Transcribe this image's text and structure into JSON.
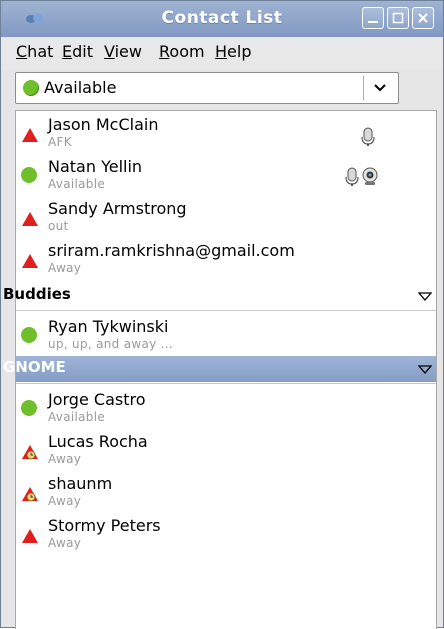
{
  "window": {
    "title": "Contact List"
  },
  "menu": {
    "items": [
      {
        "mnemonic": "C",
        "rest": "hat"
      },
      {
        "mnemonic": "E",
        "rest": "dit"
      },
      {
        "mnemonic": "V",
        "rest": "iew"
      },
      {
        "mnemonic": "R",
        "rest": "oom"
      },
      {
        "mnemonic": "H",
        "rest": "elp"
      }
    ]
  },
  "presence": {
    "selected": "Available",
    "color": "#6fbe2c"
  },
  "contacts_ungrouped": [
    {
      "name": "Jason McClain",
      "status": "AFK",
      "state": "away"
    },
    {
      "name": "Natan Yellin",
      "status": "Available",
      "state": "available"
    },
    {
      "name": "Sandy Armstrong",
      "status": "out",
      "state": "away"
    },
    {
      "name": "sriram.ramkrishna@gmail.com",
      "status": "Away",
      "state": "away"
    }
  ],
  "groups": [
    {
      "name": "Buddies",
      "contacts": [
        {
          "name": "Ryan Tykwinski",
          "status": "up, up, and away ...",
          "state": "available"
        }
      ]
    },
    {
      "name": "GNOME",
      "contacts": [
        {
          "name": "Jorge Castro",
          "status": "Available",
          "state": "available"
        },
        {
          "name": "Lucas Rocha",
          "status": "Away",
          "state": "away-idle"
        },
        {
          "name": "shaunm",
          "status": "Away",
          "state": "away-idle"
        },
        {
          "name": "Stormy Peters",
          "status": "Away",
          "state": "away"
        }
      ]
    }
  ],
  "colors": {
    "titlebar": "#8fa5cc",
    "available": "#6fbe2c",
    "away": "#e0201f",
    "group_highlight": "#8fa5cc"
  }
}
